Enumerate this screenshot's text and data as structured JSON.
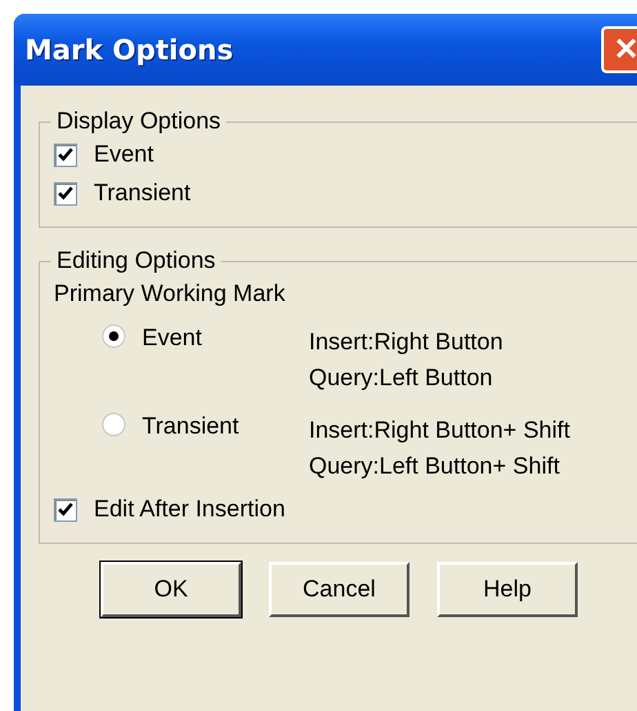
{
  "window": {
    "title": "Mark Options",
    "close_button": "✕"
  },
  "display_options": {
    "title": "Display Options",
    "items": [
      {
        "label": "Event",
        "checked": true
      },
      {
        "label": "Transient",
        "checked": true
      }
    ]
  },
  "editing_options": {
    "title": "Editing Options",
    "subtitle": "Primary Working Mark",
    "marks": [
      {
        "label": "Event",
        "selected": true,
        "hints": [
          "Insert:Right Button",
          "Query:Left Button"
        ]
      },
      {
        "label": "Transient",
        "selected": false,
        "hints": [
          "Insert:Right Button+ Shift",
          "Query:Left Button+ Shift"
        ]
      }
    ],
    "edit_after_insertion": {
      "label": "Edit After Insertion",
      "checked": true
    }
  },
  "buttons": [
    {
      "label": "OK",
      "default": true
    },
    {
      "label": "Cancel",
      "default": false
    },
    {
      "label": "Help",
      "default": false
    }
  ]
}
